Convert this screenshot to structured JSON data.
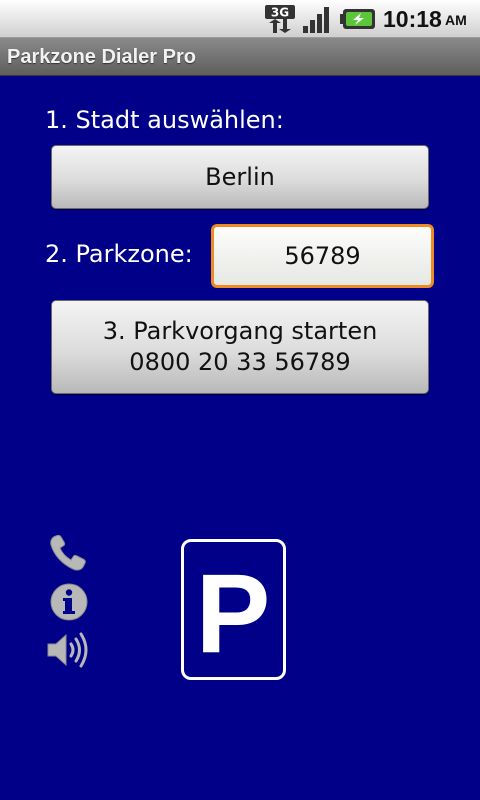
{
  "status_bar": {
    "network": "3G",
    "time": "10:18",
    "ampm": "AM"
  },
  "app": {
    "title": "Parkzone Dialer Pro"
  },
  "step1": {
    "label": "1. Stadt auswählen:",
    "city_button": "Berlin"
  },
  "step2": {
    "label": "2. Parkzone:",
    "zone_value": "56789"
  },
  "step3": {
    "line1": "3. Parkvorgang starten",
    "line2": "0800 20 33 56789"
  },
  "side_icons": [
    "phone-icon",
    "info-icon",
    "speaker-icon"
  ],
  "parking_sign": {
    "letter": "P"
  },
  "colors": {
    "background": "#000088",
    "focus_border": "#f08a24",
    "icon_gray": "#b8b8b8"
  }
}
